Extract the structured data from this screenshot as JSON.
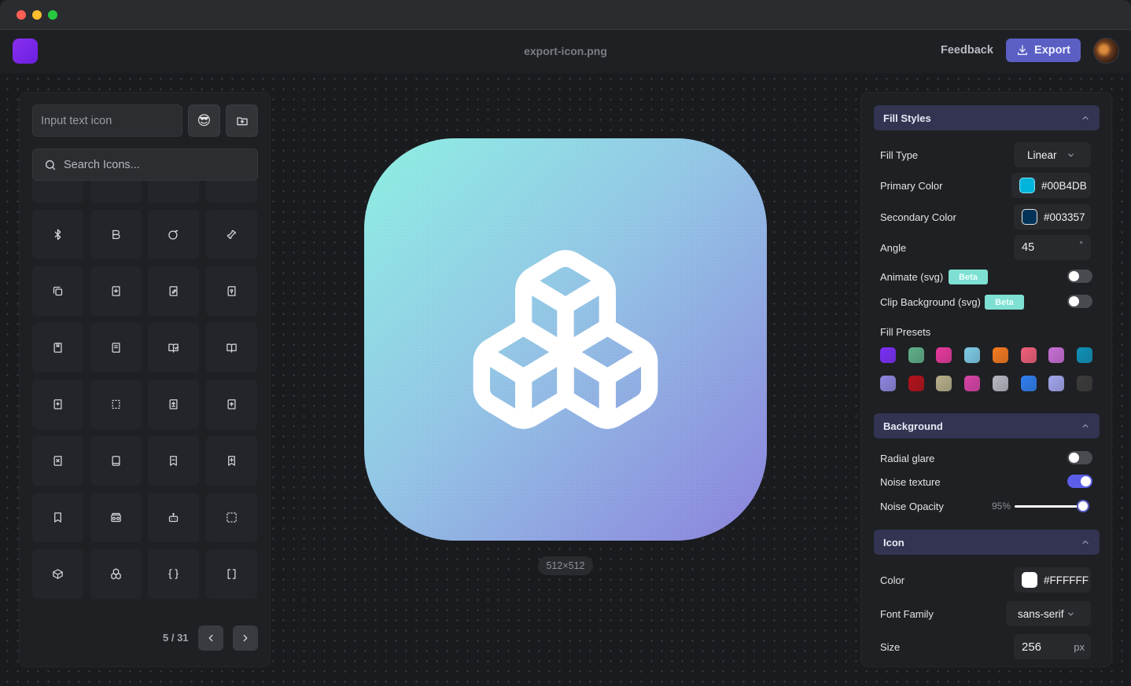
{
  "window": {
    "filename": "export-icon.png"
  },
  "header": {
    "feedback_label": "Feedback",
    "export_label": "Export"
  },
  "left": {
    "text_input_placeholder": "Input text icon",
    "search_placeholder": "Search Icons...",
    "emoji_button": "😎",
    "icons": [
      "list-icon",
      "wifi-low-icon",
      "wifi-arc-icon",
      "wifi-dot-icon",
      "bluetooth-icon",
      "bold-icon",
      "bomb-icon",
      "bone-icon",
      "book-copy-icon",
      "book-down-icon",
      "book-edit-icon",
      "book-key-icon",
      "book-marked-icon",
      "book-text-icon",
      "book-open-check-icon",
      "book-open-icon",
      "book-plus-icon",
      "book-dashed-icon",
      "book-up-icon",
      "book-up-arrow-icon",
      "book-x-icon",
      "book-icon",
      "bookmark-minus-icon",
      "bookmark-plus-icon",
      "bookmark-icon",
      "boombox-icon",
      "bot-icon",
      "box-select-icon",
      "box-icon",
      "boxes-icon",
      "braces-icon",
      "brackets-icon"
    ],
    "pager": "5 / 31"
  },
  "canvas": {
    "size_label": "512×512",
    "gradient_start": "#8ef0e4",
    "gradient_end": "#8b82dd",
    "glyph": "boxes-icon"
  },
  "right": {
    "fill_styles": {
      "title": "Fill Styles",
      "fill_type_label": "Fill Type",
      "fill_type_value": "Linear",
      "primary_label": "Primary Color",
      "primary_value": "#00B4DB",
      "secondary_label": "Secondary Color",
      "secondary_value": "#003357",
      "angle_label": "Angle",
      "angle_value": "45",
      "angle_unit": "°",
      "animate_label": "Animate (svg)",
      "animate_badge": "Beta",
      "animate_on": false,
      "clip_label": "Clip Background (svg)",
      "clip_badge": "Beta",
      "clip_on": false,
      "presets_label": "Fill Presets",
      "presets": [
        "#7b2ff7",
        "#5fb08a",
        "#e7399d",
        "#7ecbe8",
        "#f57a20",
        "#ef5f7a",
        "#c86fd6",
        "#0f92b8",
        "#8f86e0",
        "#b3121b",
        "#b8b08a",
        "#d843a6",
        "#b7b7c2",
        "#2f7ff0",
        "#a2a6ec",
        "#3b3b3b"
      ]
    },
    "background": {
      "title": "Background",
      "radial_label": "Radial glare",
      "radial_on": false,
      "noise_label": "Noise texture",
      "noise_on": true,
      "opacity_label": "Noise Opacity",
      "opacity_value": "95%"
    },
    "icon": {
      "title": "Icon",
      "color_label": "Color",
      "color_value": "#FFFFFF",
      "font_label": "Font Family",
      "font_value": "sans-serif",
      "size_label": "Size",
      "size_value": "256",
      "size_unit": "px"
    }
  }
}
